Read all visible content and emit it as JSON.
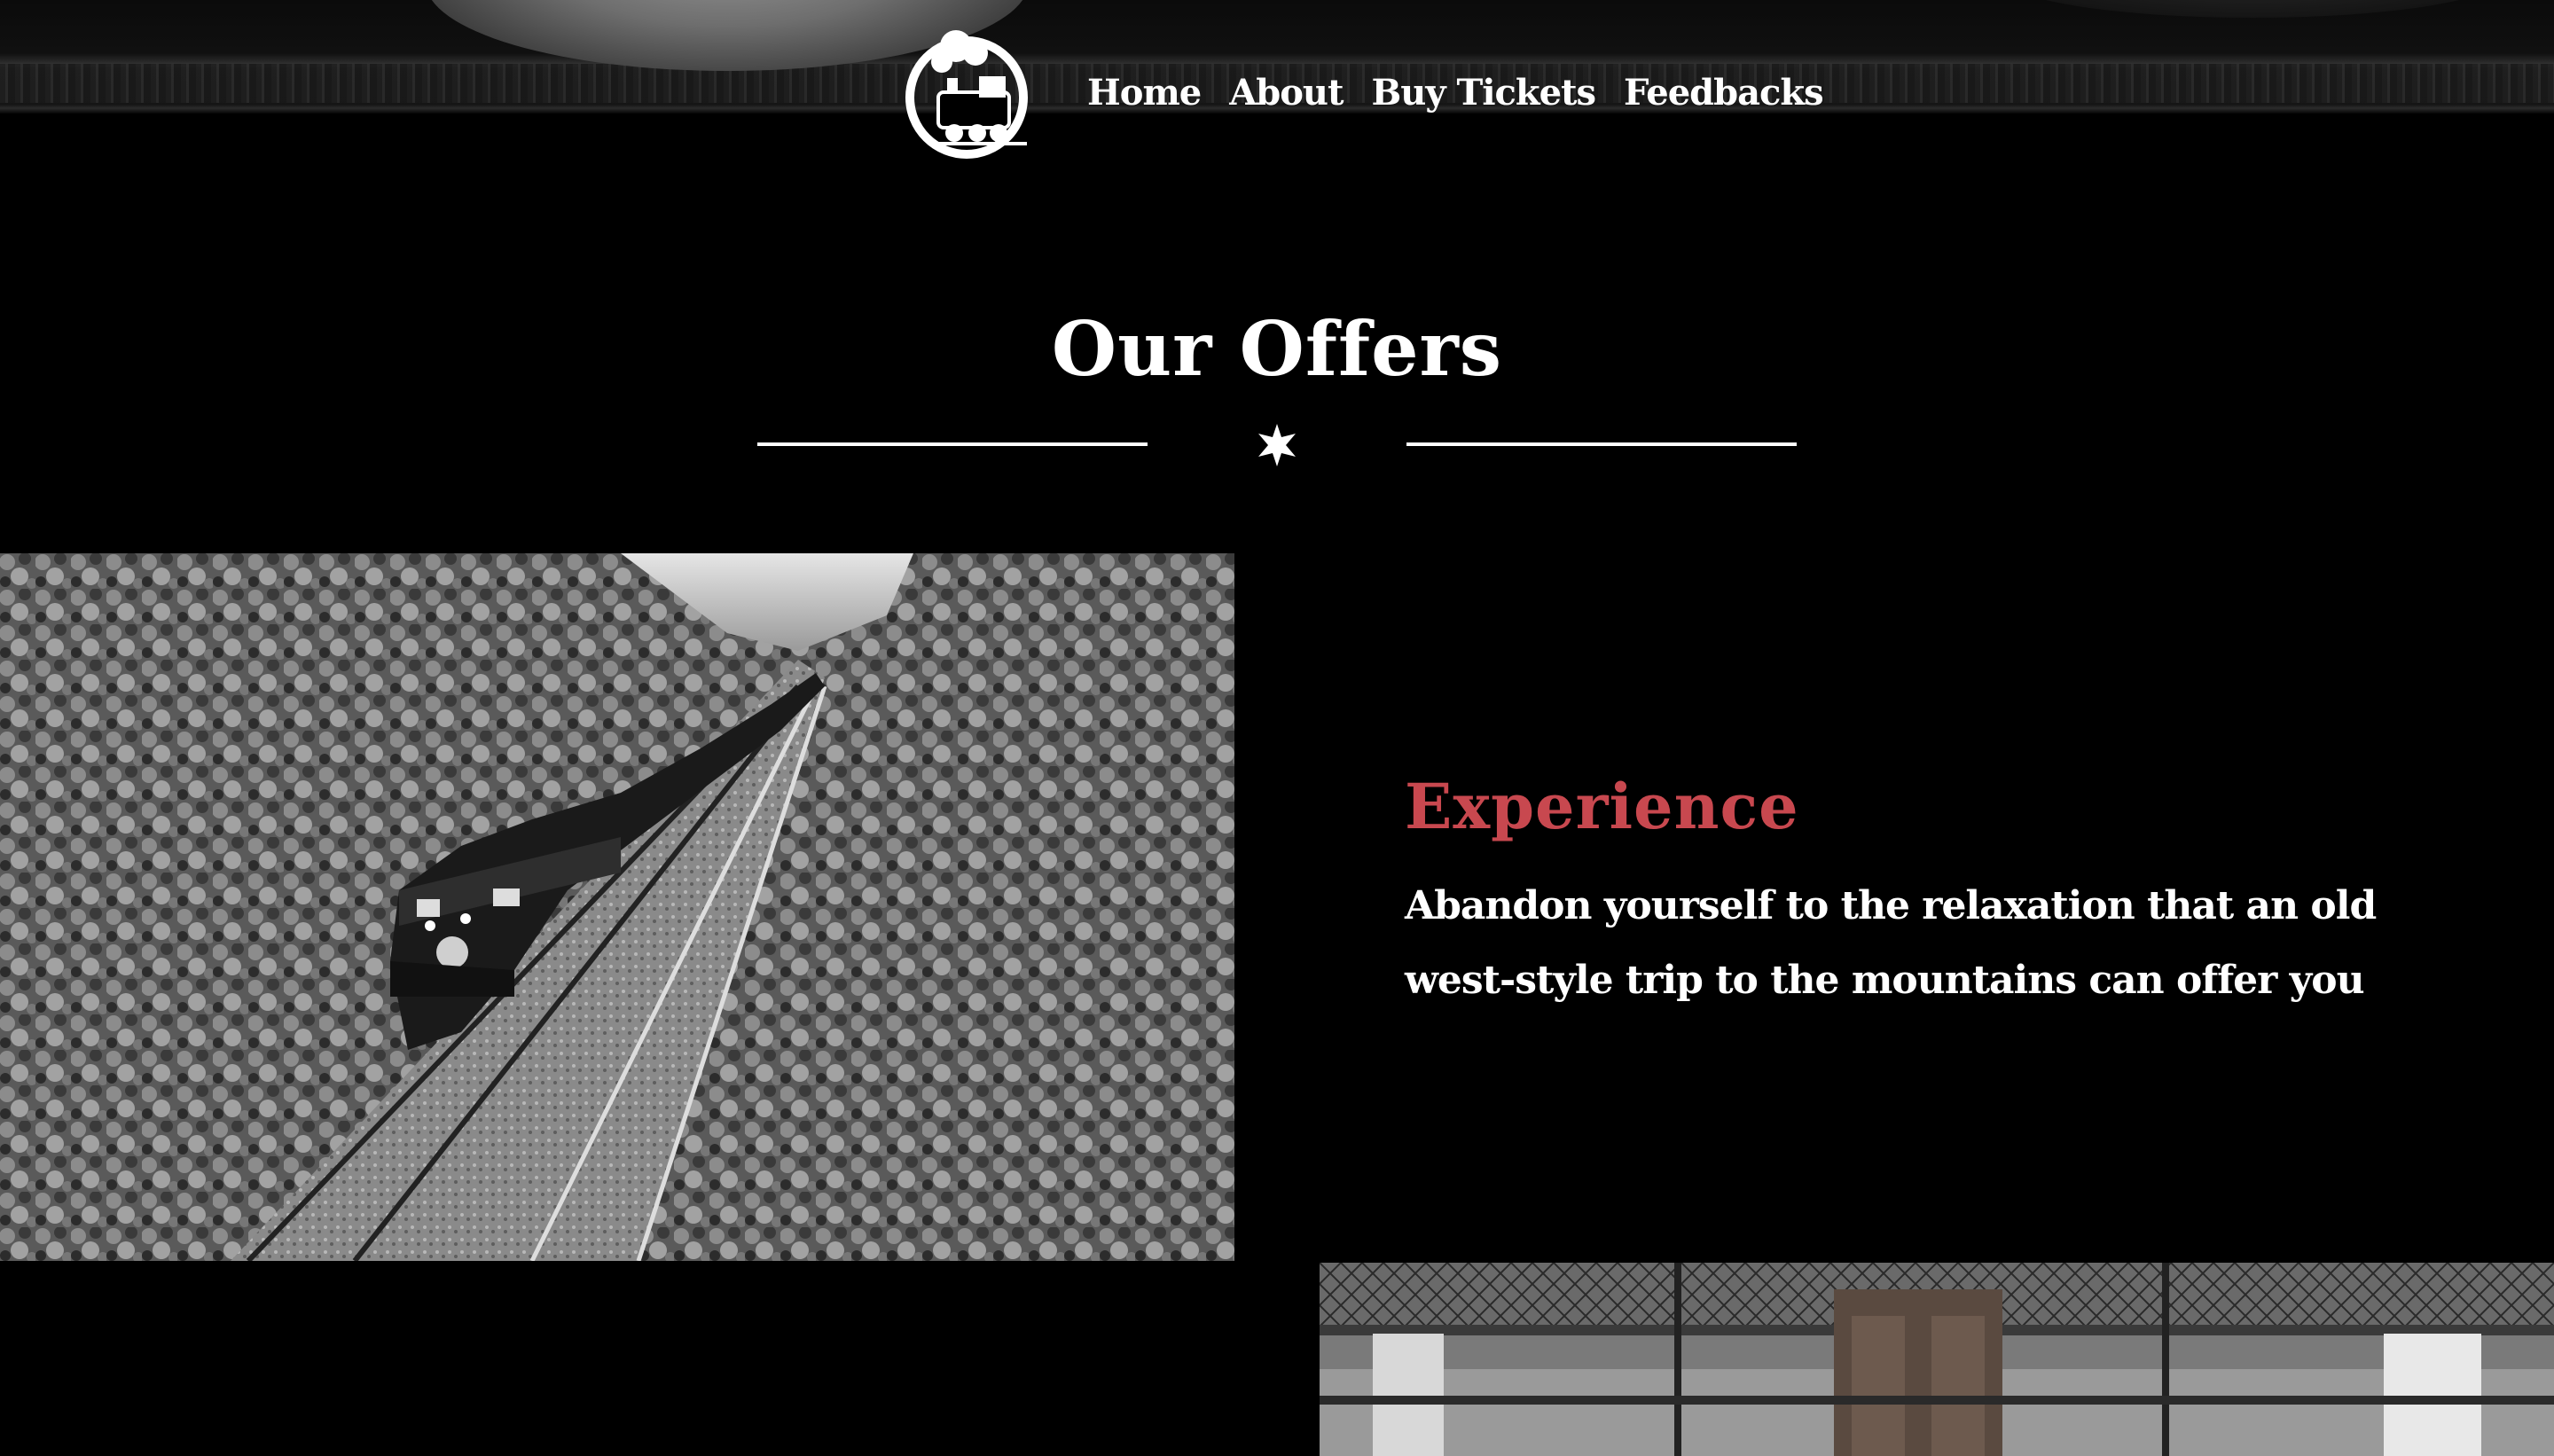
{
  "header": {
    "nav": [
      "Home",
      "About",
      "Buy Tickets",
      "Feedbacks"
    ],
    "logo_icon": "locomotive-logo-icon"
  },
  "offers": {
    "title": "Our Offers",
    "divider_icon": "star-icon",
    "item": {
      "heading": "Experience",
      "text": "Abandon yourself to the relaxation that an old west-style trip to the mountains can offer you",
      "image": "train-in-forest-photo"
    },
    "next_image": "train-interior-photo"
  },
  "colors": {
    "background": "#000000",
    "accent": "#c8484f",
    "text": "#ffffff"
  }
}
